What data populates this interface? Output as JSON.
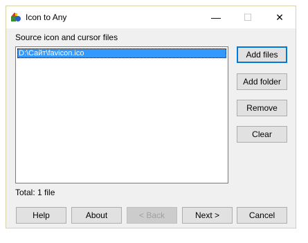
{
  "window": {
    "title": "Icon to Any",
    "controls": {
      "minimize": "—",
      "maximize": "☐",
      "close": "✕"
    }
  },
  "source": {
    "label": "Source icon and cursor files",
    "files": [
      "D:\\Сайт\\favicon.ico"
    ],
    "selected_index": 0
  },
  "side_buttons": {
    "add_files": "Add files",
    "add_folder": "Add folder",
    "remove": "Remove",
    "clear": "Clear"
  },
  "status": {
    "total": "Total: 1 file"
  },
  "footer": {
    "help": "Help",
    "about": "About",
    "back": "< Back",
    "next": "Next >",
    "cancel": "Cancel"
  },
  "colors": {
    "selection": "#3399ff",
    "default_button_border": "#0078d7",
    "window_border": "#d8d0a8"
  },
  "icons": {
    "app": "shapes-icon",
    "minimize": "minimize-icon",
    "maximize": "maximize-icon",
    "close": "close-icon"
  }
}
